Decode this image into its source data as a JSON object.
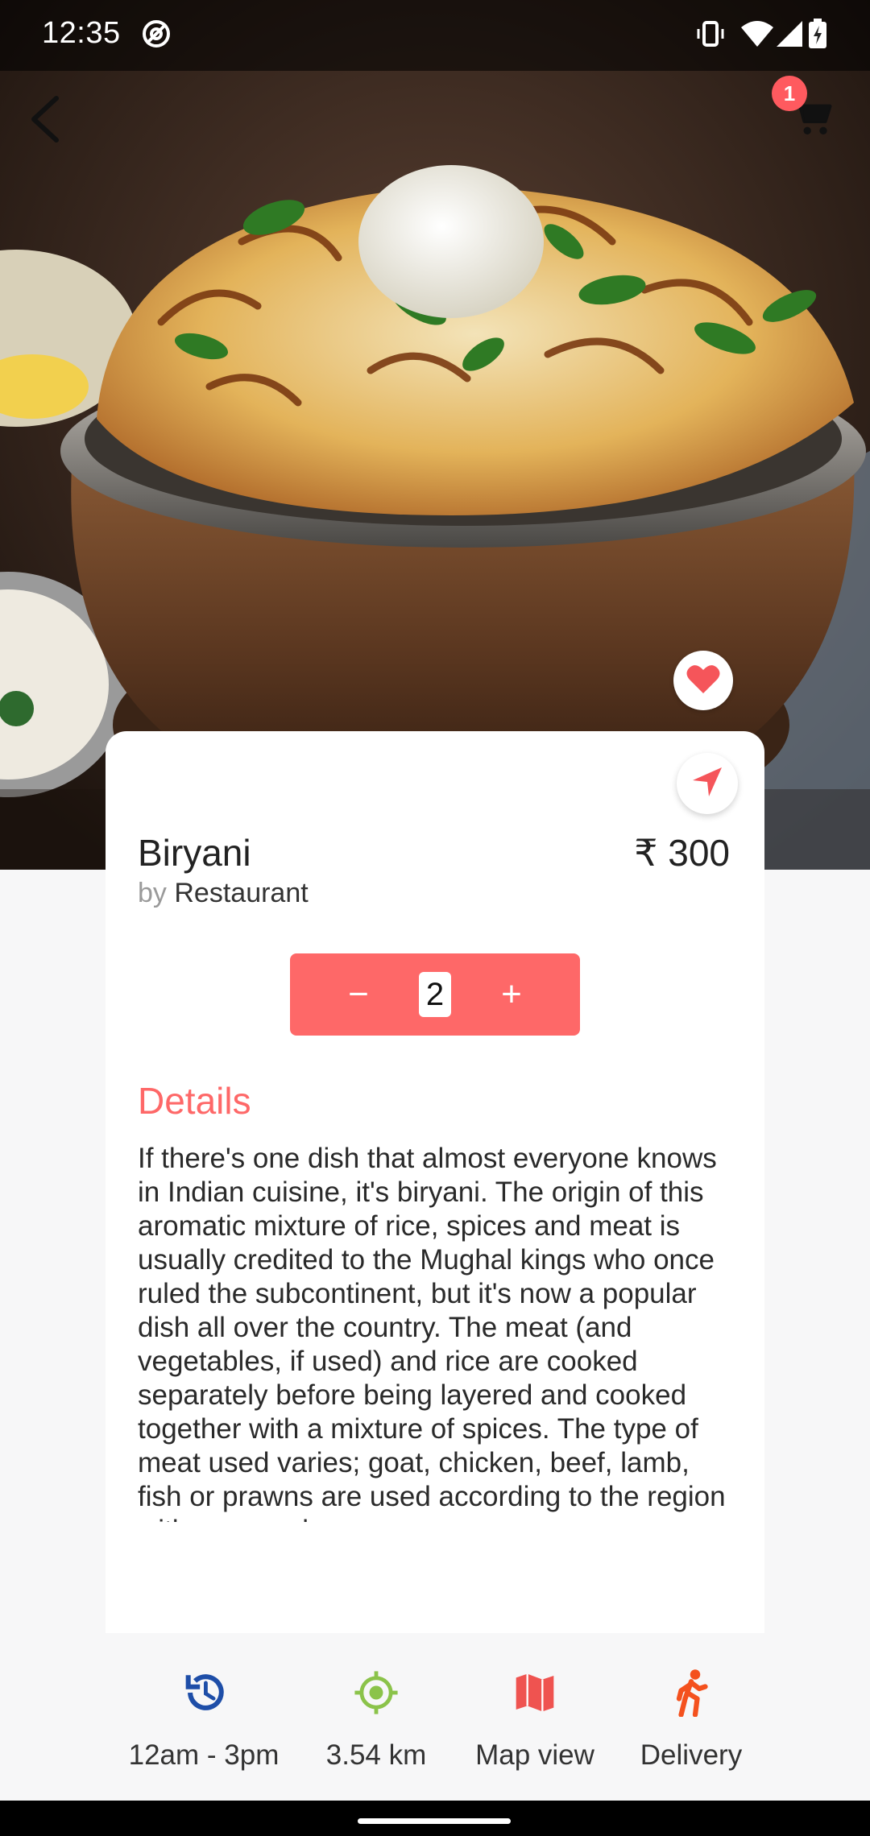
{
  "status_bar": {
    "time": "12:35",
    "icons": [
      "at-sign-icon",
      "vibrate-icon",
      "wifi-icon",
      "signal-icon",
      "battery-charging-icon"
    ]
  },
  "app_bar": {
    "back_icon": "chevron-left-icon",
    "cart_icon": "cart-icon",
    "cart_badge": "1"
  },
  "hero": {
    "image": "biryani-pot-photo",
    "favorite_icon": "heart-icon"
  },
  "product": {
    "name": "Biryani",
    "price": "₹ 300",
    "by_label": "by",
    "restaurant": "Restaurant",
    "navigate_icon": "navigation-arrow-icon"
  },
  "quantity": {
    "minus": "−",
    "value": "2",
    "plus": "+"
  },
  "details": {
    "title": "Details",
    "text": "If there's one dish that almost everyone knows in Indian cuisine, it's biryani. The origin of this aromatic mixture of rice, spices and meat is usually credited to the Mughal kings who once ruled the subcontinent, but it's now a popular dish all over the country. The meat (and vegetables, if used) and rice are cooked separately before being layered and cooked together with a mixture of spices. The type of meat used varies; goat, chicken, beef, lamb, fish or prawns are used according to the region with seasonal"
  },
  "info_bar": [
    {
      "icon": "history-icon",
      "label": "12am - 3pm",
      "color": "#1e4ea8"
    },
    {
      "icon": "gps-target-icon",
      "label": "3.54 km",
      "color": "#8bc34a"
    },
    {
      "icon": "map-icon",
      "label": "Map view",
      "color": "#ef5350"
    },
    {
      "icon": "walking-person-icon",
      "label": "Delivery",
      "color": "#f4511e"
    }
  ],
  "colors": {
    "accent": "#fe6868",
    "card": "#ffffff",
    "background": "#f7f7f8"
  }
}
